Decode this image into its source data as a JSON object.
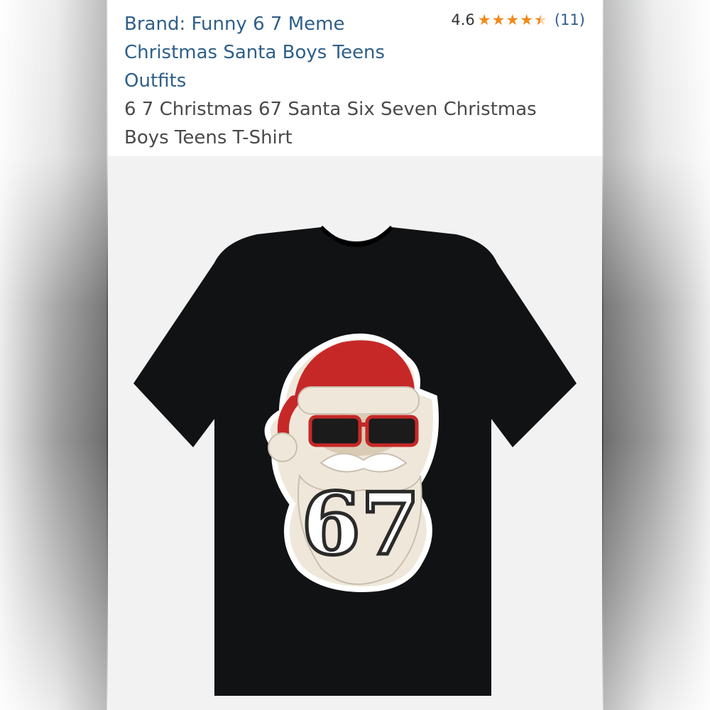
{
  "listing": {
    "brand_link": "Brand: Funny 6 7 Meme Christmas Santa Boys Teens Outfits",
    "product_title": "6 7 Christmas 67 Santa Six Seven Christmas Boys Teens T-Shirt",
    "rating_value": "4.6",
    "rating_count": "(11)",
    "stars": {
      "full": 4,
      "half": 1,
      "color": "#f08a1c"
    }
  },
  "product_image": {
    "shirt_color": "#101214",
    "graphic_text": "67",
    "hat_color": "#c62828",
    "beard_color": "#efe8da"
  }
}
